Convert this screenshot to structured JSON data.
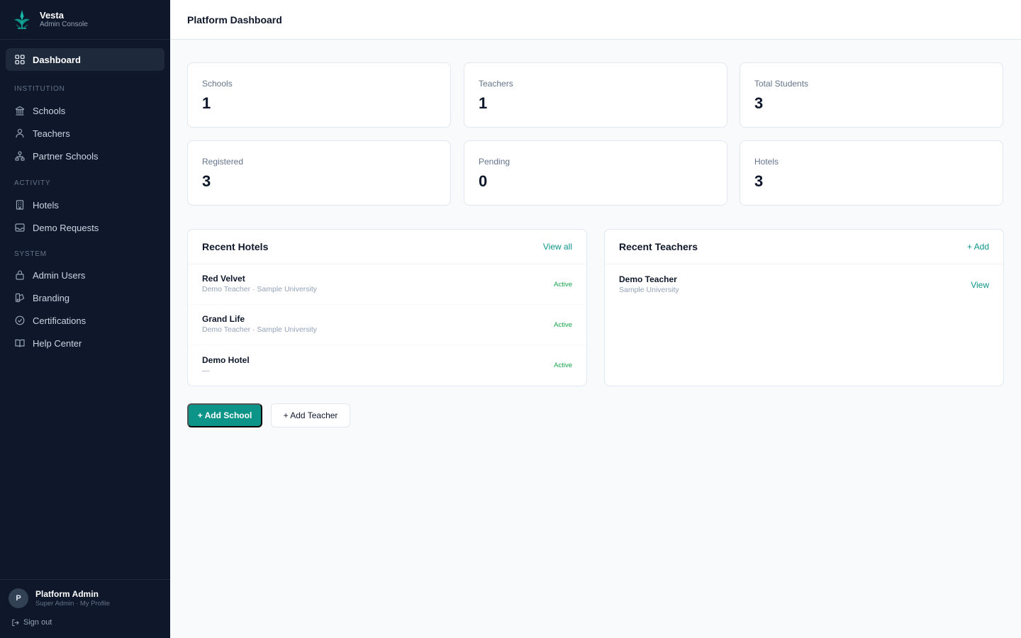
{
  "brand": {
    "name": "Vesta",
    "subtitle": "Admin Console",
    "accent": "#0d9488"
  },
  "sidebar": {
    "dashboard": {
      "label": "Dashboard",
      "icon": "grid-icon"
    },
    "sections": [
      {
        "title": "INSTITUTION",
        "items": [
          {
            "label": "Schools",
            "icon": "building-icon"
          },
          {
            "label": "Teachers",
            "icon": "users-icon"
          },
          {
            "label": "Partner Schools",
            "icon": "network-icon"
          }
        ]
      },
      {
        "title": "ACTIVITY",
        "items": [
          {
            "label": "Hotels",
            "icon": "hotel-icon"
          },
          {
            "label": "Demo Requests",
            "icon": "inbox-icon"
          }
        ]
      },
      {
        "title": "SYSTEM",
        "items": [
          {
            "label": "Admin Users",
            "icon": "lock-icon"
          },
          {
            "label": "Branding",
            "icon": "palette-icon"
          },
          {
            "label": "Certifications",
            "icon": "check-circle-icon"
          },
          {
            "label": "Help Center",
            "icon": "book-icon"
          }
        ]
      }
    ]
  },
  "user": {
    "initial": "P",
    "name": "Platform Admin",
    "role": "Super Admin · My Profile",
    "signout": "Sign out"
  },
  "header": {
    "title": "Platform Dashboard"
  },
  "stats": [
    {
      "label": "Schools",
      "value": "1"
    },
    {
      "label": "Teachers",
      "value": "1"
    },
    {
      "label": "Total Students",
      "value": "3"
    },
    {
      "label": "Registered",
      "value": "3"
    },
    {
      "label": "Pending",
      "value": "0"
    },
    {
      "label": "Hotels",
      "value": "3"
    }
  ],
  "recent_hotels": {
    "title": "Recent Hotels",
    "link": "View all",
    "rows": [
      {
        "name": "Red Velvet",
        "sub": "Demo Teacher · Sample University",
        "status": "Active"
      },
      {
        "name": "Grand Life",
        "sub": "Demo Teacher · Sample University",
        "status": "Active"
      },
      {
        "name": "Demo Hotel",
        "sub": "—",
        "status": "Active"
      }
    ]
  },
  "recent_teachers": {
    "title": "Recent Teachers",
    "link": "+ Add",
    "rows": [
      {
        "name": "Demo Teacher",
        "sub": "Sample University",
        "action": "View"
      }
    ]
  },
  "actions": {
    "add_school": "+ Add School",
    "add_teacher": "+ Add Teacher"
  }
}
